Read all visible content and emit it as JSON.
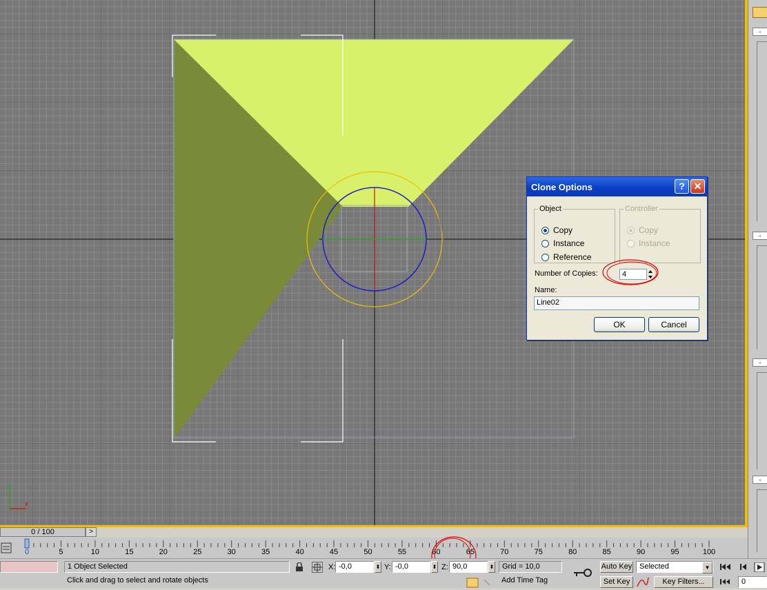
{
  "dialog": {
    "title": "Clone Options",
    "help_glyph": "?",
    "close_glyph": "✕",
    "object_group": {
      "legend": "Object",
      "options": [
        "Copy",
        "Instance",
        "Reference"
      ],
      "selected": "Copy"
    },
    "controller_group": {
      "legend": "Controller",
      "options": [
        "Copy",
        "Instance"
      ],
      "selected": "Copy",
      "enabled": false
    },
    "copies_label": "Number of Copies:",
    "copies_value": "4",
    "name_label": "Name:",
    "name_value": "Line02",
    "ok_label": "OK",
    "cancel_label": "Cancel"
  },
  "timeline": {
    "frame_display": "0 / 100",
    "next_glyph": ">",
    "ticks": [
      "0",
      "5",
      "10",
      "15",
      "20",
      "25",
      "30",
      "35",
      "40",
      "45",
      "50",
      "55",
      "60",
      "65",
      "70",
      "75",
      "80",
      "85",
      "90",
      "95",
      "100"
    ]
  },
  "status_bar": {
    "selection": "1 Object Selected",
    "prompt": "Click and drag to select and rotate objects",
    "x_label": "X:",
    "x_value": "-0,0",
    "y_label": "Y:",
    "y_value": "-0,0",
    "z_label": "Z:",
    "z_value": "90,0",
    "grid": "Grid = 10,0",
    "add_time_tag": "Add Time Tag",
    "auto_key": "Auto Key",
    "set_key": "Set Key",
    "key_mode": "Selected",
    "key_filters": "Key Filters...",
    "current_frame": "0"
  },
  "viewport": {
    "axis_y": "y",
    "axis_x": "x",
    "colors": {
      "grid_bg": "#787878",
      "light_face": "#d9f06b",
      "dark_face": "#7a8a38",
      "border": "#f0c000",
      "annotation": "#e00000"
    }
  }
}
